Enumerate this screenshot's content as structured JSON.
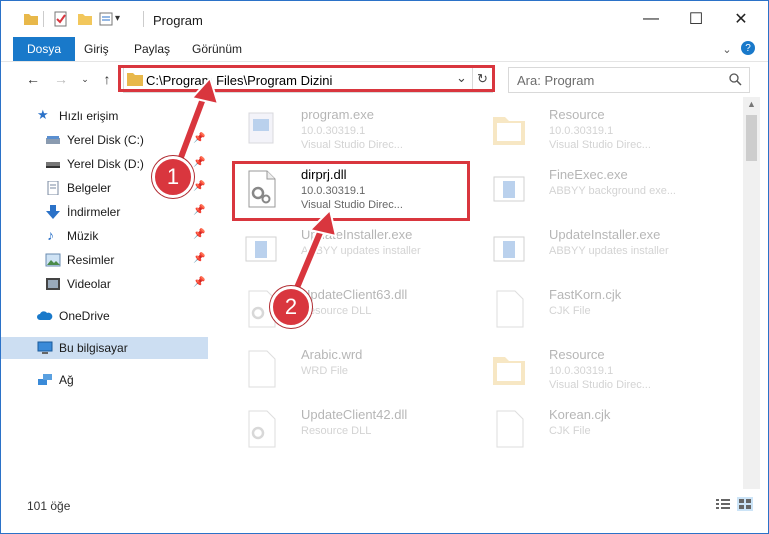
{
  "window": {
    "title": "Program",
    "controls": {
      "minimize": "—",
      "maximize": "☐",
      "close": "✕"
    }
  },
  "ribbon": {
    "tabs": [
      "Dosya",
      "Giriş",
      "Paylaş",
      "Görünüm"
    ],
    "collapse_icon": "chevron-down-icon",
    "help_icon": "help-icon"
  },
  "address": {
    "path": "C:\\Program Files\\Program Dizini",
    "dropdown": "⌄",
    "refresh": "↻"
  },
  "search": {
    "placeholder": "Ara: Program"
  },
  "sidebar": {
    "items": [
      {
        "label": "Hızlı erişim",
        "icon": "star-icon",
        "pinned": false
      },
      {
        "label": "Yerel Disk (C:)",
        "icon": "drive-icon",
        "pinned": true
      },
      {
        "label": "Yerel Disk (D:)",
        "icon": "drive-icon",
        "pinned": true
      },
      {
        "label": "Belgeler",
        "icon": "documents-icon",
        "pinned": true
      },
      {
        "label": "İndirmeler",
        "icon": "download-icon",
        "pinned": true
      },
      {
        "label": "Müzik",
        "icon": "music-icon",
        "pinned": true
      },
      {
        "label": "Resimler",
        "icon": "pictures-icon",
        "pinned": true
      },
      {
        "label": "Videolar",
        "icon": "videos-icon",
        "pinned": true
      },
      {
        "label": "OneDrive",
        "icon": "cloud-icon",
        "pinned": false
      },
      {
        "label": "Bu bilgisayar",
        "icon": "computer-icon",
        "pinned": false,
        "selected": true
      },
      {
        "label": "Ağ",
        "icon": "network-icon",
        "pinned": false
      }
    ]
  },
  "files": [
    {
      "name": "program.exe",
      "line2": "10.0.30319.1",
      "line3": "Visual Studio Direc...",
      "icon": "exe-icon",
      "faded": true
    },
    {
      "name": "Resource",
      "line2": "10.0.30319.1",
      "line3": "Visual Studio Direc...",
      "icon": "folder-icon",
      "faded": true
    },
    {
      "name": "dirprj.dll",
      "line2": "10.0.30319.1",
      "line3": "Visual Studio Direc...",
      "icon": "dll-icon",
      "faded": false
    },
    {
      "name": "FineExec.exe",
      "line2": "ABBYY background exe...",
      "line3": "",
      "icon": "app-window-icon",
      "faded": true
    },
    {
      "name": "UpdateInstaller.exe",
      "line2": "ABBYY updates installer",
      "line3": "",
      "icon": "app-window-icon",
      "faded": true
    },
    {
      "name": "UpdateInstaller.exe",
      "line2": "ABBYY updates installer",
      "line3": "",
      "icon": "app-window-icon",
      "faded": true
    },
    {
      "name": "UpdateClient63.dll",
      "line2": "Resource DLL",
      "line3": "",
      "icon": "dll-icon",
      "faded": true
    },
    {
      "name": "FastKorn.cjk",
      "line2": "CJK File",
      "line3": "",
      "icon": "file-icon",
      "faded": true
    },
    {
      "name": "Arabic.wrd",
      "line2": "WRD File",
      "line3": "",
      "icon": "file-icon",
      "faded": true
    },
    {
      "name": "Resource",
      "line2": "10.0.30319.1",
      "line3": "Visual Studio Direc...",
      "icon": "folder-icon",
      "faded": true
    },
    {
      "name": "UpdateClient42.dll",
      "line2": "Resource DLL",
      "line3": "",
      "icon": "dll-icon",
      "faded": true
    },
    {
      "name": "Korean.cjk",
      "line2": "CJK File",
      "line3": "",
      "icon": "file-icon",
      "faded": true
    }
  ],
  "status": {
    "count": "101 öğe"
  },
  "annotations": {
    "step1": "1",
    "step2": "2"
  },
  "colors": {
    "accent": "#1979ca",
    "highlight": "#d9363e",
    "selected": "#ccdef2"
  }
}
